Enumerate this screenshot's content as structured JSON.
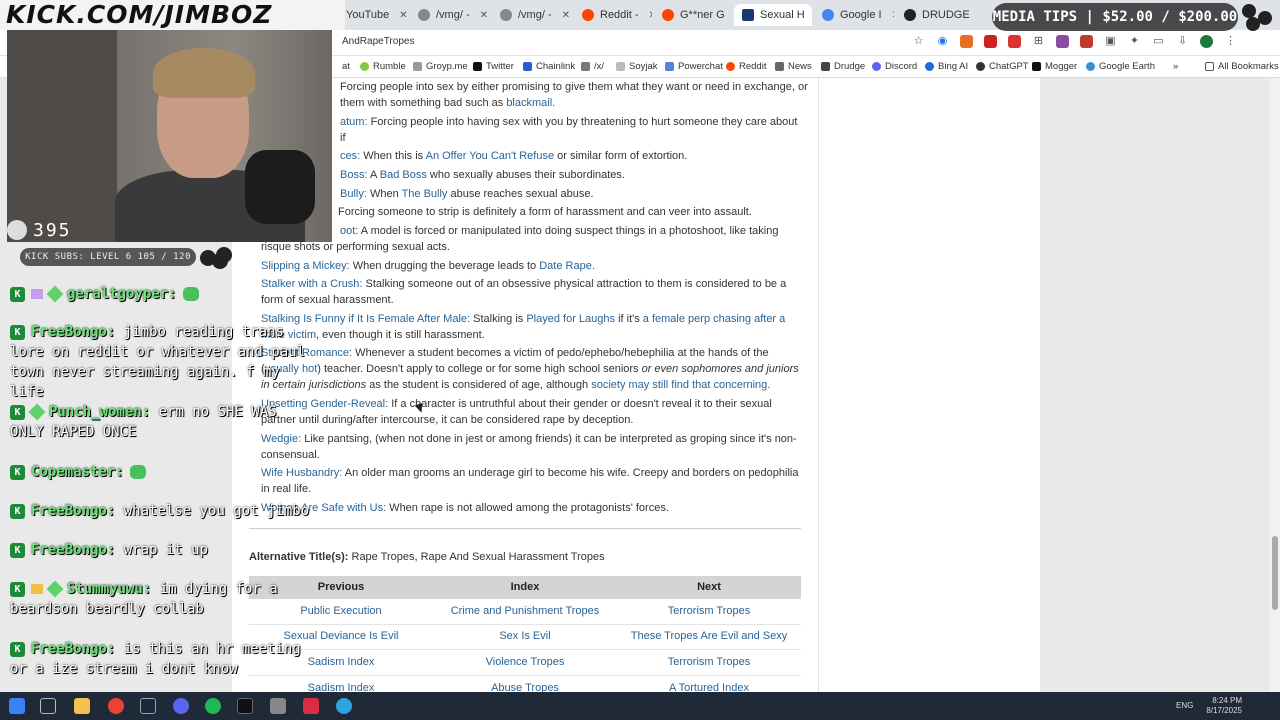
{
  "browser": {
    "tabs": [
      {
        "label": "YouTube",
        "color": "#ff0000"
      },
      {
        "label": "/vmg/ -",
        "color": "#888888"
      },
      {
        "label": "/vmg/ -",
        "color": "#888888"
      },
      {
        "label": "Reddit -",
        "color": "#ff4500"
      },
      {
        "label": "G**ner G",
        "color": "#ff4500"
      },
      {
        "label": "Sexual H",
        "color": "#1a3a6b",
        "active": true
      },
      {
        "label": "Google I",
        "color": "#4285f4"
      },
      {
        "label": "DRUDGE",
        "color": "#222222"
      }
    ],
    "url_visible": "AndRapeTropes",
    "bookmarks": [
      "Rumble",
      "Groyp.me",
      "Twitter",
      "Chainlink",
      "/x/",
      "Soyjak",
      "Powerchat",
      "Reddit",
      "News",
      "Drudge",
      "Discord",
      "Bing AI",
      "ChatGPT",
      "Mogger",
      "Google Earth"
    ],
    "all_bookmarks_label": "All Bookmarks",
    "bm_left": "at"
  },
  "overlay": {
    "logo_text": "KICK.COM/JIMBOZ",
    "viewer_count": "395",
    "media_tips": "MEDIA TIPS | $52.00 / $200.00",
    "kick_subs": "KICK SUBS: LEVEL 6 105 / 120"
  },
  "chat": [
    {
      "user": "geraltgoyper:",
      "text": ""
    },
    {
      "user": "FreeBongo:",
      "text": "jimbo reading trans lore on reddit or whatever and paul town never streaming again. f my life"
    },
    {
      "user": "Punch_women:",
      "text": "erm no SHE WAS ONLY RAPED ONCE"
    },
    {
      "user": "Copemaster:",
      "text": ""
    },
    {
      "user": "FreeBongo:",
      "text": "whatelse you got jimbo"
    },
    {
      "user": "FreeBongo:",
      "text": "wrap it up"
    },
    {
      "user": "Stummyuwu:",
      "text": "im dying for a beardson beardly collab"
    },
    {
      "user": "FreeBongo:",
      "text": "is this an hr meeting or a ize stream i dont know"
    }
  ],
  "tropes": [
    {
      "name": "",
      "text": "Forcing people into sex by either promising to give them what they want or need in exchange, or them with something bad such as ",
      "link": "blackmail."
    },
    {
      "name": "atum:",
      "text": " Forcing people into having sex with you by threatening to hurt someone they care about if"
    },
    {
      "name": "ces:",
      "text": " When this is ",
      "link": "An Offer You Can't Refuse",
      "tail": " or similar form of extortion."
    },
    {
      "name": "Boss:",
      "text": " A ",
      "link": "Bad Boss",
      "tail": " who sexually abuses their subordinates."
    },
    {
      "name": "Bully:",
      "text": " When ",
      "link": "The Bully",
      "tail": " abuse reaches sexual abuse."
    },
    {
      "name": "",
      "text": "Forcing someone to strip is definitely a form of harassment and can veer into assault."
    },
    {
      "name": "oot:",
      "text": " A model is forced or manipulated into doing suspect things in a photoshoot, like taking risque shots or performing sexual acts."
    },
    {
      "name": "Slipping a Mickey:",
      "text": " When drugging the beverage leads to ",
      "link": "Date Rape."
    },
    {
      "name": "Stalker with a Crush:",
      "text": " Stalking someone out of an obsessive physical attraction to them is considered to be a form of sexual harassment."
    },
    {
      "name": "Stalking Is Funny if It Is Female After Male:",
      "text": " Stalking is ",
      "link": "Played for Laughs",
      "tail": " if it's ",
      "link2": "a female perp chasing after a male victim",
      "tail2": ", even though it is still harassment."
    },
    {
      "name": "Student Romance:",
      "text": " Whenever a student becomes a victim of pedo/ephebo/hebephilia at the hands of the (",
      "link": "usually hot",
      "tail": ") teacher. Doesn't apply to college or for some high school seniors ",
      "italic": "or even sophomores and juniors in certain jurisdictions",
      "tail2": " as the student is considered of age, although ",
      "link2": "society may still find that concerning."
    },
    {
      "name": "Upsetting Gender-Reveal:",
      "text": " If a character is untruthful about their gender or doesn't reveal it to their sexual partner until during/after intercourse, it can be considered rape by deception."
    },
    {
      "name": "Wedgie:",
      "text": " Like pantsing, (when not done in jest or among friends) it can be interpreted as groping since it's non-consensual."
    },
    {
      "name": "Wife Husbandry:",
      "text": " An older man grooms an underage girl to become his wife. Creepy and borders on pedophilia in real life."
    },
    {
      "name": "Women Are Safe with Us:",
      "text": " When rape is not allowed among the protagonists' forces."
    }
  ],
  "alt_title": {
    "label": "Alternative Title(s):",
    "value": " Rape Tropes, Rape And Sexual Harassment Tropes"
  },
  "nav": {
    "headers": [
      "Previous",
      "Index",
      "Next"
    ],
    "rows": [
      [
        "Public Execution",
        "Crime and Punishment Tropes",
        "Terrorism Tropes"
      ],
      [
        "Sexual Deviance Is Evil",
        "Sex Is Evil",
        "These Tropes Are Evil and Sexy"
      ],
      [
        "Sadism Index",
        "Violence Tropes",
        "Terrorism Tropes"
      ],
      [
        "Sadism Index",
        "Abuse Tropes",
        "A Tortured Index"
      ]
    ]
  },
  "taskbar": {
    "lang": "ENG",
    "time": "8:24 PM",
    "date": "8/17/2025"
  }
}
